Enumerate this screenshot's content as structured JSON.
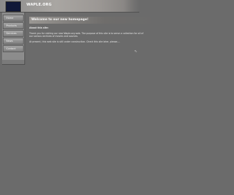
{
  "header": {
    "site_name": "WAPLE.ORG",
    "logo_icon": "flag-logo-icon"
  },
  "sidebar": {
    "items": [
      {
        "label": "Home"
      },
      {
        "label": "Products"
      },
      {
        "label": "Services"
      },
      {
        "label": "News"
      },
      {
        "label": "Contact"
      }
    ]
  },
  "main": {
    "banner_title": "Welcome to our new homepage!",
    "section_title": "About this site:",
    "paragraph_line_1": "Thank you for visiting our new Waple.org web. The purpose of this site is to serve a collection for all of",
    "paragraph_line_2": "our various archives of movies and sources.",
    "paragraph_line_3": "At present, this web site is still under construction. Check this site later, please...."
  },
  "colors": {
    "background": "#6b6b6b",
    "text": "#e8e8e8"
  }
}
